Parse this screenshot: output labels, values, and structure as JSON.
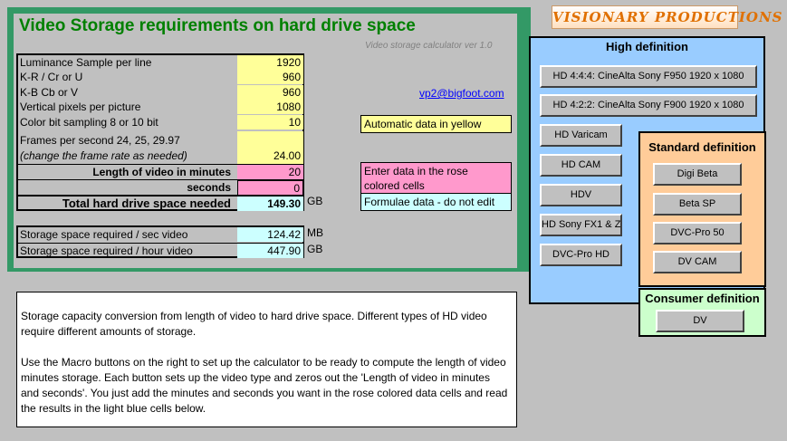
{
  "header": {
    "title": "Video Storage requirements on hard drive space",
    "version": "Video storage calculator ver 1.0"
  },
  "logo": {
    "text": "VISIONARY PRODUCTIONS"
  },
  "inputs": {
    "luminance_label": "Luminance Sample per line",
    "luminance_value": "1920",
    "kr_label": "K-R / Cr or U",
    "kr_value": "960",
    "kb_label": "K-B Cb or V",
    "kb_value": "960",
    "vertical_label": "Vertical pixels per picture",
    "vertical_value": "1080",
    "colorbit_label": "Color bit sampling 8 or 10 bit",
    "colorbit_value": "10",
    "fps_label": "Frames per second 24, 25, 29.97",
    "fps_note": "(change the frame rate as needed)",
    "fps_value": "24.00",
    "minutes_label": "Length of video in minutes",
    "minutes_value": "20",
    "seconds_label": "seconds",
    "seconds_value": "0",
    "total_label": "Total hard drive space needed",
    "total_value": "149.30",
    "total_unit": "GB"
  },
  "storage": {
    "sec_label": "Storage space required / sec video",
    "sec_value": "124.42",
    "sec_unit": "MB",
    "hour_label": "Storage space required / hour video",
    "hour_value": "447.90",
    "hour_unit": "GB"
  },
  "email": "vp2@bigfoot.com",
  "legends": {
    "yellow": "Automatic data in yellow",
    "rose_line1": "Enter data in the rose",
    "rose_line2": "colored cells",
    "blue": "Formulae data - do not edit"
  },
  "description": {
    "p1": "Storage capacity conversion from length of video to hard drive space. Different types of HD video require different amounts of storage.",
    "p2": "Use the Macro buttons on the right to set up the calculator to be ready to compute the length of video minutes storage.  Each button sets up the video type and zeros out the 'Length of video in minutes and seconds'.  You just add the minutes and seconds you want in the rose colored data cells and read the results in the light blue cells below."
  },
  "hd": {
    "title": "High definition",
    "b1": "HD 4:4:4: CineAlta Sony F950 1920 x 1080",
    "b2": "HD 4:2:2: CineAlta Sony F900 1920 x 1080",
    "b3": "HD Varicam",
    "b4": "HD CAM",
    "b5": "HDV",
    "b6": "HD Sony FX1 & Z",
    "b7": "DVC-Pro HD"
  },
  "sd": {
    "title": "Standard definition",
    "b1": "Digi Beta",
    "b2": "Beta SP",
    "b3": "DVC-Pro 50",
    "b4": "DV CAM"
  },
  "cd": {
    "title": "Consumer definition",
    "b1": "DV"
  }
}
